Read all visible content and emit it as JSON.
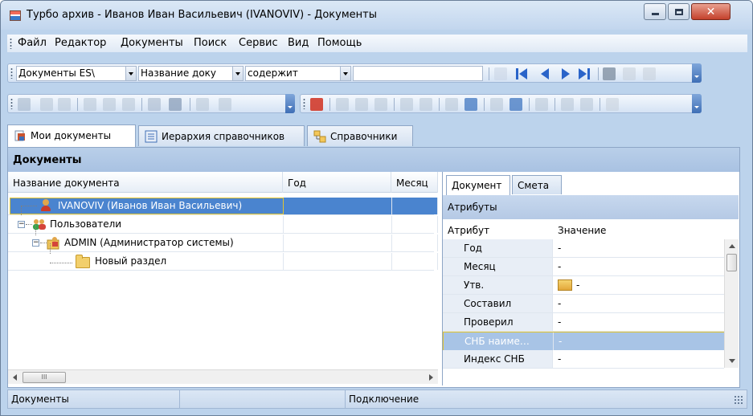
{
  "window": {
    "title": "Турбо архив - Иванов Иван Васильевич (IVANOVIV) - Документы"
  },
  "menu": [
    "Файл",
    "Редактор",
    "Документы",
    "Поиск",
    "Сервис",
    "Вид",
    "Помощь"
  ],
  "search_toolbar": {
    "doc_type": "Документы ES\\",
    "field": "Название доку",
    "condition": "содержит",
    "query": ""
  },
  "tabs": [
    {
      "label": "Мои документы",
      "icon": "documents-icon"
    },
    {
      "label": "Иерархия справочников",
      "icon": "hierarchy-icon"
    },
    {
      "label": "Справочники",
      "icon": "directories-icon"
    }
  ],
  "panel": {
    "header": "Документы",
    "columns": [
      "Название документа",
      "Год",
      "Месяц"
    ],
    "tree": [
      {
        "label": "IVANOVIV (Иванов Иван Васильевич)",
        "icon": "user-icon",
        "selected": true
      },
      {
        "label": "Пользователи",
        "icon": "users-icon",
        "selected": false
      },
      {
        "label": "ADMIN (Администратор системы)",
        "icon": "admin-icon",
        "selected": false
      },
      {
        "label": "Новый раздел",
        "icon": "folder-icon",
        "selected": false
      }
    ],
    "hscroll_thumb": "III"
  },
  "properties": {
    "tabs": [
      "Документ",
      "Смета"
    ],
    "header": "Атрибуты",
    "col_attr": "Атрибут",
    "col_value": "Значение",
    "rows": [
      {
        "name": "Год",
        "value": "-"
      },
      {
        "name": "Месяц",
        "value": "-"
      },
      {
        "name": "Утв.",
        "value": "-"
      },
      {
        "name": "Составил",
        "value": "-"
      },
      {
        "name": "Проверил",
        "value": "-"
      },
      {
        "name": "СНБ наиме…",
        "value": "-"
      },
      {
        "name": "Индекс СНБ",
        "value": "-"
      }
    ]
  },
  "status": {
    "left": "Документы",
    "middle": "",
    "right": "Подключение"
  }
}
